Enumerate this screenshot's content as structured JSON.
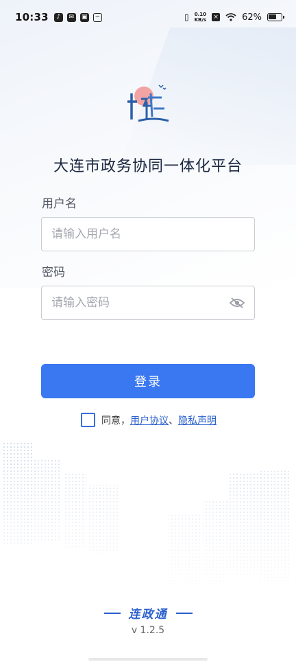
{
  "status_bar": {
    "time": "10:33",
    "net_speed_value": "0.10",
    "net_speed_unit": "KB/s",
    "battery": "62%"
  },
  "app_title": "大连市政务协同一体化平台",
  "username": {
    "label": "用户名",
    "placeholder": "请输入用户名",
    "value": ""
  },
  "password": {
    "label": "密码",
    "placeholder": "请输入密码",
    "value": ""
  },
  "login_button": "登录",
  "agreement": {
    "prefix": "同意，",
    "user_agreement": "用户协议",
    "separator": "、",
    "privacy": "隐私声明"
  },
  "brand_name": "连政通",
  "version": "v 1.2.5",
  "colors": {
    "primary": "#3a78f2",
    "link": "#2a5fcc"
  }
}
